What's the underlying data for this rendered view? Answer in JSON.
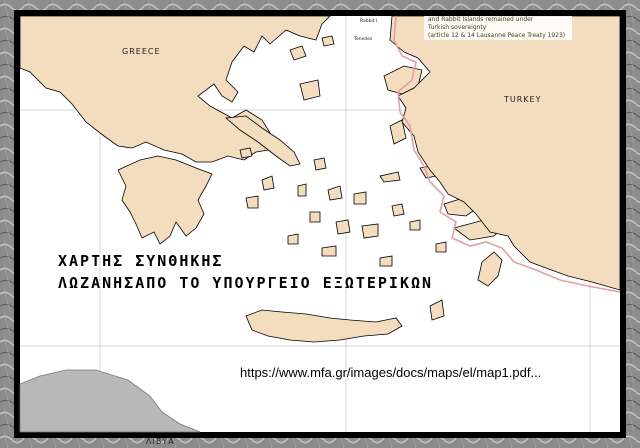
{
  "map": {
    "labels": {
      "greece": "GREECE",
      "turkey": "TURKEY",
      "libya": "ΛΙΒΥΑ",
      "rabbit": "Rabbit I.",
      "tenedos": "Tenedos"
    },
    "note": {
      "line1": "and Rabbit Islands remained under",
      "line2": "Turkish sovereignty",
      "line3": "(article 12 & 14 Lausanne Peace Treaty 1923)"
    },
    "colors": {
      "land": "#f4dcbe",
      "sea": "#ffffff",
      "other_land": "#b8b8b8",
      "border": "#e0a0a8",
      "frame": "#9a9a9a"
    }
  },
  "caption": {
    "line1": "ΧΑΡΤΗΣ ΣΥΝΘΗΚΗΣ",
    "line2": "ΛΩΖΑΝΗΣΑΠΟ ΤΟ ΥΠΟΥΡΓΕΙΟ ΕΞΩΤΕΡΙΚΩΝ"
  },
  "source_url": "https://www.mfa.gr/images/docs/maps/el/map1.pdf..."
}
